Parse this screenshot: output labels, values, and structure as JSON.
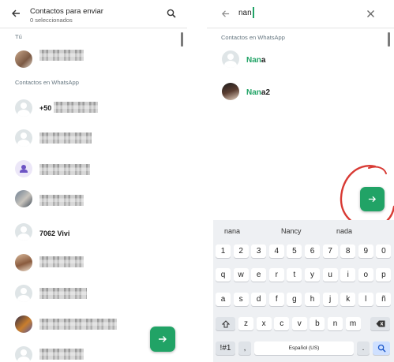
{
  "left": {
    "title": "Contactos para enviar",
    "subtitle": "0 seleccionados",
    "section_self": "Tú",
    "section_contacts": "Contactos en WhatsApp",
    "contacts": [
      {
        "name": "+50",
        "avatar": "photo"
      },
      {
        "name": "",
        "avatar": "default"
      },
      {
        "name": "",
        "avatar": "group"
      },
      {
        "name": "",
        "avatar": "photo"
      },
      {
        "name": "7062 Vivi",
        "avatar": "default"
      },
      {
        "name": "",
        "avatar": "photo"
      },
      {
        "name": "",
        "avatar": "default"
      },
      {
        "name": "",
        "avatar": "photo"
      },
      {
        "name": "",
        "avatar": "default"
      }
    ]
  },
  "right": {
    "search_value": "nan",
    "section_contacts": "Contactos en WhatsApp",
    "results": [
      {
        "match": "Nan",
        "rest": "a"
      },
      {
        "match": "Nan",
        "rest": "a2"
      }
    ],
    "suggestions": [
      "nana",
      "Nancy",
      "nada"
    ],
    "keys": {
      "numbers": [
        "1",
        "2",
        "3",
        "4",
        "5",
        "6",
        "7",
        "8",
        "9",
        "0"
      ],
      "row1": [
        "q",
        "w",
        "e",
        "r",
        "t",
        "y",
        "u",
        "i",
        "o",
        "p"
      ],
      "row2": [
        "a",
        "s",
        "d",
        "f",
        "g",
        "h",
        "j",
        "k",
        "l",
        "ñ"
      ],
      "row3": [
        "z",
        "x",
        "c",
        "v",
        "b",
        "n",
        "m"
      ],
      "symbols": "!#1",
      "comma": ",",
      "space": "Español (US)",
      "period": "."
    }
  },
  "colors": {
    "accent": "#21a366",
    "annotation": "#d83a34"
  }
}
